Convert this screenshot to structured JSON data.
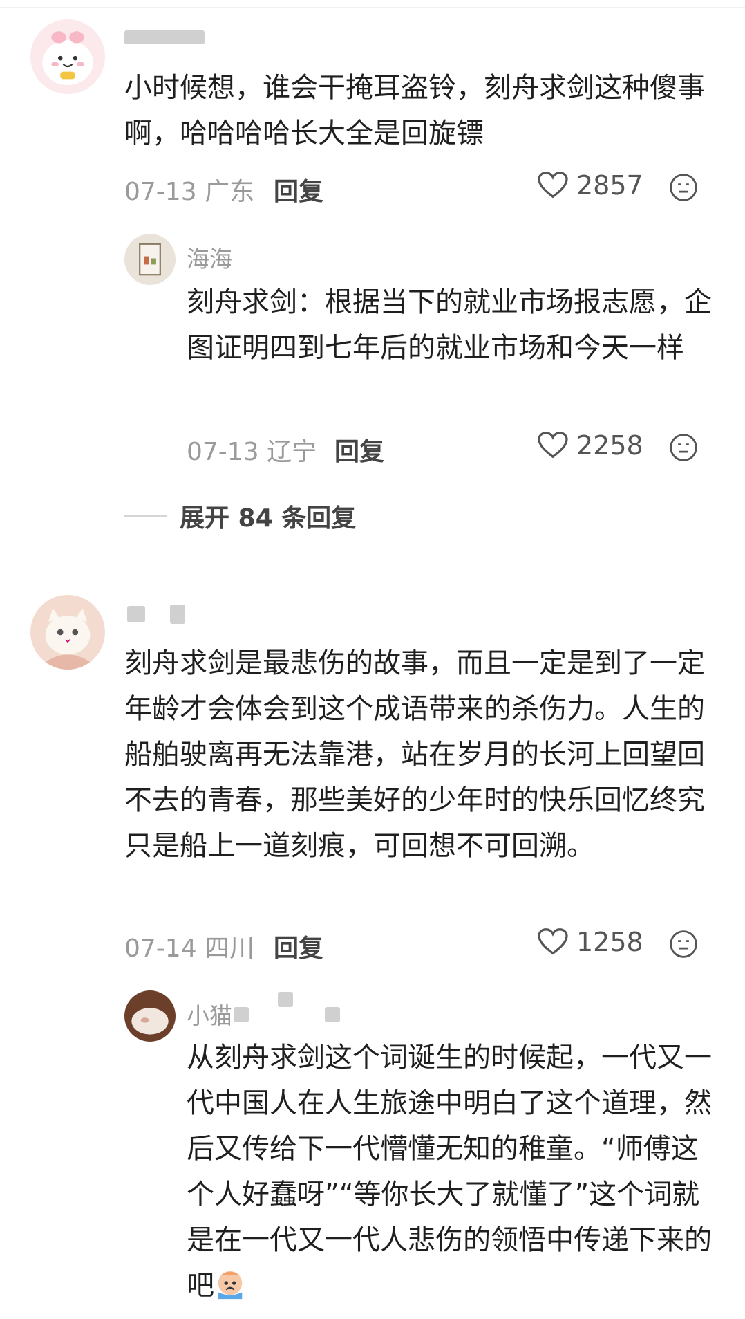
{
  "comments": [
    {
      "text": "小时候想，谁会干掩耳盗铃，刻舟求剑这种傻事啊，哈哈哈哈长大全是回旋镖",
      "date": "07-13",
      "location": "广东",
      "reply_label": "回复",
      "likes": "2857",
      "avatar_icon": "pink-cartoon-avatar",
      "reply": {
        "name": "海海",
        "text": "刻舟求剑：根据当下的就业市场报志愿，企图证明四到七年后的就业市场和今天一样",
        "date": "07-13",
        "location": "辽宁",
        "reply_label": "回复",
        "likes": "2258"
      },
      "expand_label": "展开 84 条回复"
    },
    {
      "text": "刻舟求剑是最悲伤的故事，而且一定是到了一定年龄才会体会到这个成语带来的杀伤力。人生的船舶驶离再无法靠港，站在岁月的长河上回望回不去的青春，那些美好的少年时的快乐回忆终究只是船上一道刻痕，可回想不可回溯。",
      "date": "07-14",
      "location": "四川",
      "reply_label": "回复",
      "likes": "1258",
      "avatar_icon": "cat-avatar",
      "reply": {
        "name": "小猫",
        "text": "从刻舟求剑这个词诞生的时候起，一代又一代中国人在人生旅途中明白了这个道理，然后又传给下一代懵懂无知的稚童。“师傅这个人好蠢呀”“等你长大了就懂了”这个词就是在一代又一代人悲伤的领悟中传递下来的吧",
        "emoji_icon": "crying-emoji-icon"
      }
    }
  ],
  "colors": {
    "meta": "#9a9a9a",
    "text": "#1f1f1f",
    "bg": "#ffffff"
  }
}
